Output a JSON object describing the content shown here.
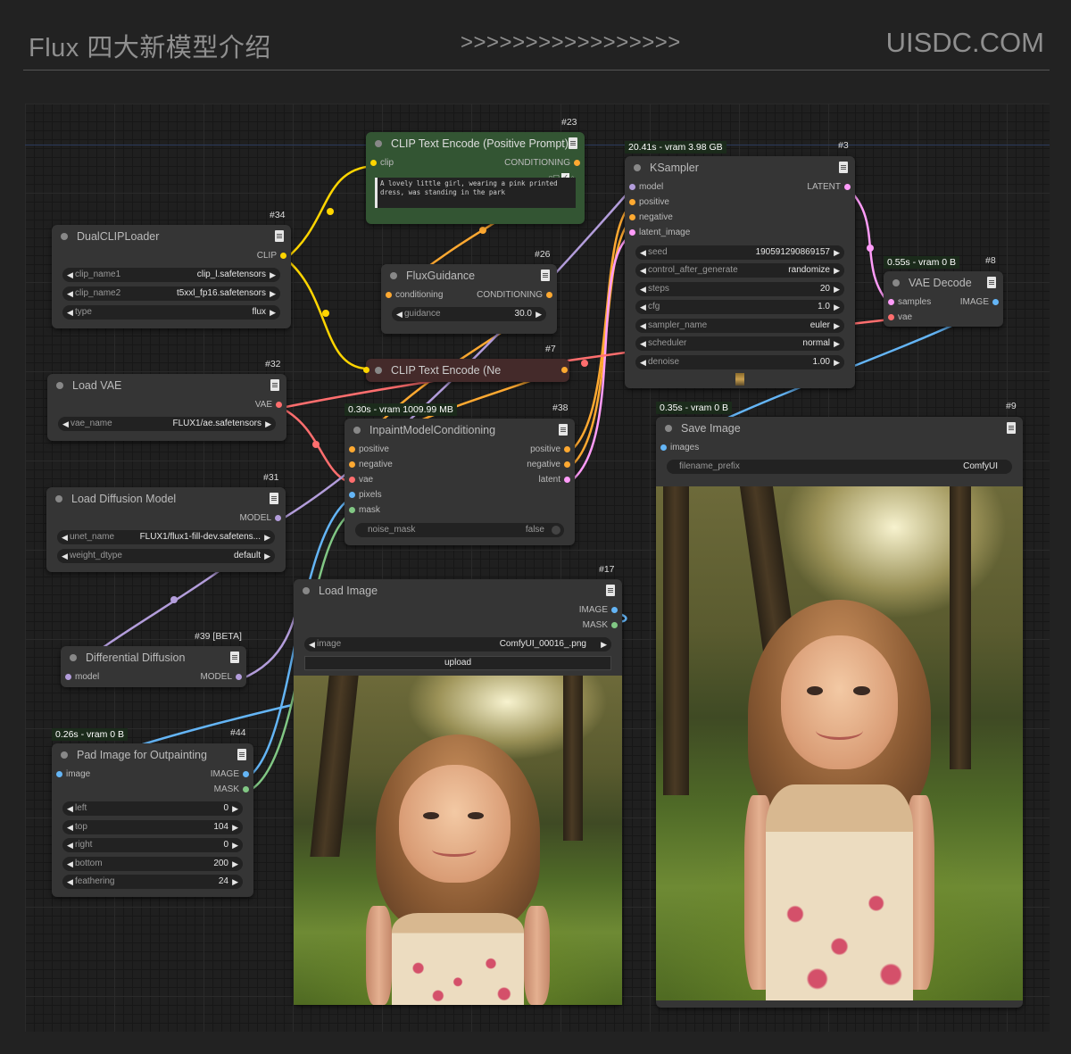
{
  "header": {
    "title": "Flux 四大新模型介绍",
    "arrows": ">>>>>>>>>>>>>>>>>",
    "brand": "UISDC.COM"
  },
  "colors": {
    "clip": "#ffd500",
    "conditioning": "#ffa931",
    "vae": "#ff6e6e",
    "model": "#b39ddb",
    "latent": "#ff9cf9",
    "image": "#64b5f6",
    "mask": "#81c784"
  },
  "nodes": {
    "clip_text_pos": {
      "id": "#23",
      "title": "CLIP Text Encode (Positive Prompt)",
      "in_clip": "clip",
      "out_conditioning": "CONDITIONING",
      "prompt": "A lovely little girl, wearing a pink printed dress, was standing in the park"
    },
    "dual_clip": {
      "id": "#34",
      "title": "DualCLIPLoader",
      "out_clip": "CLIP",
      "widgets": [
        {
          "label": "clip_name1",
          "value": "clip_l.safetensors"
        },
        {
          "label": "clip_name2",
          "value": "t5xxl_fp16.safetensors"
        },
        {
          "label": "type",
          "value": "flux"
        }
      ]
    },
    "flux_guidance": {
      "id": "#26",
      "title": "FluxGuidance",
      "in_conditioning": "conditioning",
      "out_conditioning": "CONDITIONING",
      "widget": {
        "label": "guidance",
        "value": "30.0"
      }
    },
    "clip_text_neg": {
      "id": "#7",
      "title": "CLIP Text Encode (Ne"
    },
    "ksampler": {
      "id": "#3",
      "status": "20.41s - vram 3.98 GB",
      "title": "KSampler",
      "inputs": [
        "model",
        "positive",
        "negative",
        "latent_image"
      ],
      "out_latent": "LATENT",
      "widgets": [
        {
          "label": "seed",
          "value": "190591290869157"
        },
        {
          "label": "control_after_generate",
          "value": "randomize"
        },
        {
          "label": "steps",
          "value": "20"
        },
        {
          "label": "cfg",
          "value": "1.0"
        },
        {
          "label": "sampler_name",
          "value": "euler"
        },
        {
          "label": "scheduler",
          "value": "normal"
        },
        {
          "label": "denoise",
          "value": "1.00"
        }
      ]
    },
    "vae_decode": {
      "id": "#8",
      "status": "0.55s - vram 0 B",
      "title": "VAE Decode",
      "in_samples": "samples",
      "in_vae": "vae",
      "out_image": "IMAGE"
    },
    "load_vae": {
      "id": "#32",
      "title": "Load VAE",
      "out_vae": "VAE",
      "widget": {
        "label": "vae_name",
        "value": "FLUX1/ae.safetensors"
      }
    },
    "inpaint": {
      "id": "#38",
      "status": "0.30s - vram 1009.99 MB",
      "title": "InpaintModelConditioning",
      "in_positive": "positive",
      "in_negative": "negative",
      "in_vae": "vae",
      "in_pixels": "pixels",
      "in_mask": "mask",
      "out_positive": "positive",
      "out_negative": "negative",
      "out_latent": "latent",
      "widget": {
        "label": "noise_mask",
        "value": "false"
      }
    },
    "save_image": {
      "id": "#9",
      "status": "0.35s - vram 0 B",
      "title": "Save Image",
      "in_images": "images",
      "widget": {
        "label": "filename_prefix",
        "value": "ComfyUI"
      }
    },
    "load_diffusion": {
      "id": "#31",
      "title": "Load Diffusion Model",
      "out_model": "MODEL",
      "widgets": [
        {
          "label": "unet_name",
          "value": "FLUX1/flux1-fill-dev.safetens..."
        },
        {
          "label": "weight_dtype",
          "value": "default"
        }
      ]
    },
    "load_image": {
      "id": "#17",
      "title": "Load Image",
      "out_image": "IMAGE",
      "out_mask": "MASK",
      "widget": {
        "label": "image",
        "value": "ComfyUI_00016_.png"
      },
      "upload": "upload"
    },
    "diff_diffusion": {
      "id": "#39 [BETA]",
      "title": "Differential Diffusion",
      "in_model": "model",
      "out_model": "MODEL"
    },
    "pad_image": {
      "id": "#44",
      "status": "0.26s - vram 0 B",
      "title": "Pad Image for Outpainting",
      "in_image": "image",
      "out_image": "IMAGE",
      "out_mask": "MASK",
      "widgets": [
        {
          "label": "left",
          "value": "0"
        },
        {
          "label": "top",
          "value": "104"
        },
        {
          "label": "right",
          "value": "0"
        },
        {
          "label": "bottom",
          "value": "200"
        },
        {
          "label": "feathering",
          "value": "24"
        }
      ]
    }
  }
}
